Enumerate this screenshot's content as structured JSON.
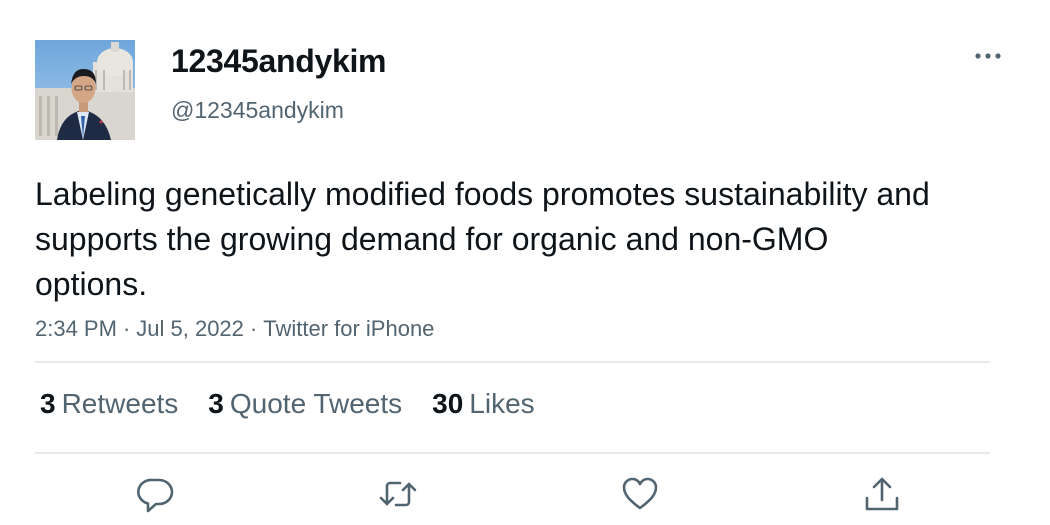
{
  "author": {
    "display_name": "12345andykim",
    "handle": "@12345andykim"
  },
  "tweet": {
    "text": "Labeling genetically modified foods promotes sustainability and supports the growing demand for organic and non-GMO options.",
    "time": "2:34 PM",
    "date": "Jul 5, 2022",
    "source": "Twitter for iPhone",
    "separator": "·"
  },
  "stats": {
    "retweets_count": "3",
    "retweets_label": "Retweets",
    "quotes_count": "3",
    "quotes_label": "Quote Tweets",
    "likes_count": "30",
    "likes_label": "Likes"
  },
  "icons": {
    "more": "more-horizontal-icon",
    "reply": "reply-icon",
    "retweet": "retweet-icon",
    "like": "heart-icon",
    "share": "share-icon"
  },
  "colors": {
    "text_primary": "#0f1419",
    "text_secondary": "#536471",
    "divider": "#e6e9eb"
  }
}
